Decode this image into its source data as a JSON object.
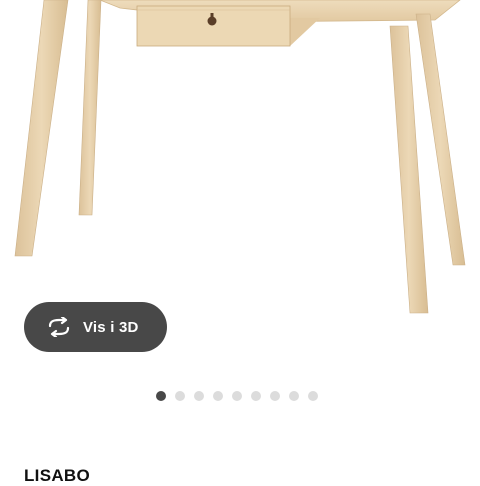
{
  "product": {
    "name": "LISABO"
  },
  "viewer": {
    "button_label": "Vis i 3D",
    "icon": "rotate-3d-icon"
  },
  "gallery": {
    "total_images": 9,
    "active_index": 0
  },
  "colors": {
    "button_bg": "#484848",
    "dot_active": "#484848",
    "dot_inactive": "#dcdcdc",
    "wood": "#e9d3ad"
  }
}
